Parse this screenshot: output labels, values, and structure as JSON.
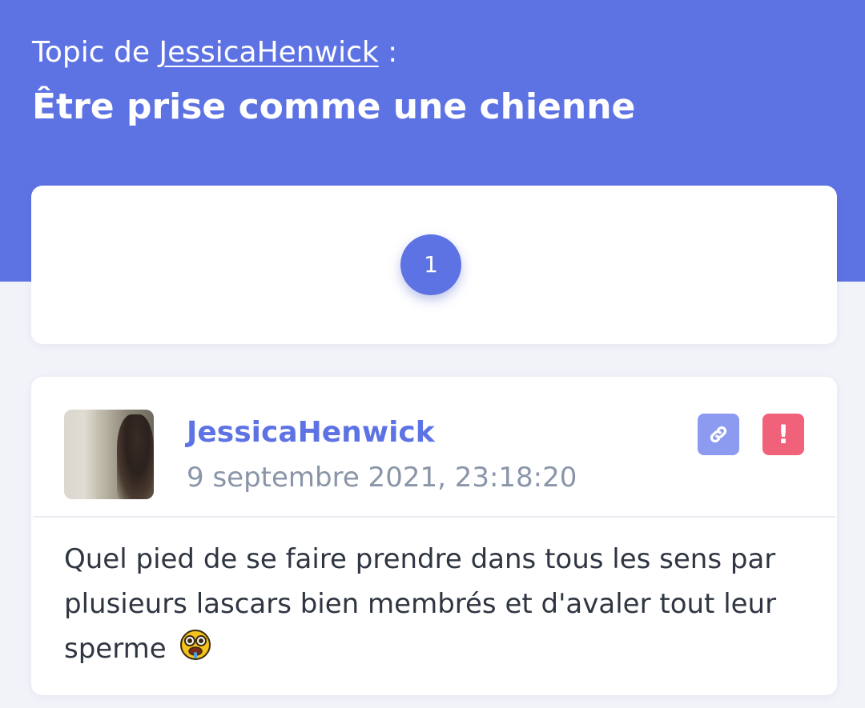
{
  "header": {
    "topic_prefix": "Topic de",
    "topic_author": "JessicaHenwick",
    "topic_suffix": " :",
    "title": "Être prise comme une chienne"
  },
  "pagination": {
    "current_page": "1"
  },
  "post": {
    "author": "JessicaHenwick",
    "date": "9 septembre 2021, 23:18:20",
    "message": "Quel pied de se faire prendre dans tous les sens par plusieurs lascars bien membrés et d'avaler tout leur sperme",
    "emoji": "drooling-face-emoji",
    "actions": {
      "link_icon": "link-icon",
      "report_icon": "exclamation-icon",
      "report_label": "!"
    }
  },
  "colors": {
    "accent": "#5e73e3",
    "link_button": "#8c9af0",
    "report_button": "#f0627a",
    "background": "#f1f3f9"
  }
}
